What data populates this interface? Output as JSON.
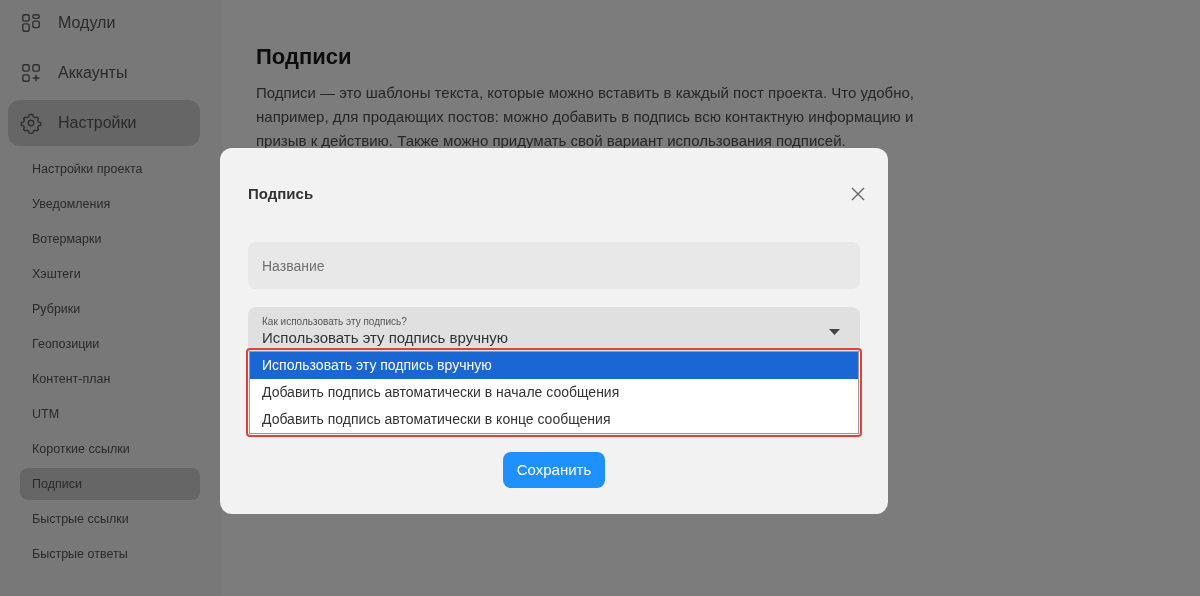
{
  "sidebar": {
    "items": [
      {
        "label": "Модули",
        "kind": "modules",
        "selected": false
      },
      {
        "label": "Аккаунты",
        "kind": "accounts",
        "selected": false
      },
      {
        "label": "Настройки",
        "kind": "settings",
        "selected": true,
        "children": [
          {
            "label": "Настройки проекта",
            "selected": false
          },
          {
            "label": "Уведомления",
            "selected": false
          },
          {
            "label": "Вотермарки",
            "selected": false
          },
          {
            "label": "Хэштеги",
            "selected": false
          },
          {
            "label": "Рубрики",
            "selected": false
          },
          {
            "label": "Геопозиции",
            "selected": false
          },
          {
            "label": "Контент-план",
            "selected": false
          },
          {
            "label": "UTM",
            "selected": false
          },
          {
            "label": "Короткие ссылки",
            "selected": false
          },
          {
            "label": "Подписи",
            "selected": true
          },
          {
            "label": "Быстрые ссылки",
            "selected": false
          },
          {
            "label": "Быстрые ответы",
            "selected": false
          }
        ]
      }
    ]
  },
  "page": {
    "title": "Подписи",
    "description": "Подписи — это шаблоны текста, которые можно вставить в каждый пост проекта. Что удобно, например, для продающих постов: можно добавить в подпись всю контактную информацию и призыв к действию. Также можно придумать свой вариант использования подписей."
  },
  "dialog": {
    "title": "Подпись",
    "name_field": {
      "placeholder": "Название"
    },
    "select": {
      "label": "Как использовать эту подпись?",
      "value": "Использовать эту подпись вручную",
      "expanded": true,
      "options": [
        {
          "label": "Использовать эту подпись вручную",
          "selected": true
        },
        {
          "label": "Добавить подпись автоматически в начале сообщения",
          "selected": false
        },
        {
          "label": "Добавить подпись автоматически в конце сообщения",
          "selected": false
        }
      ]
    },
    "save_button": "Сохранить"
  }
}
